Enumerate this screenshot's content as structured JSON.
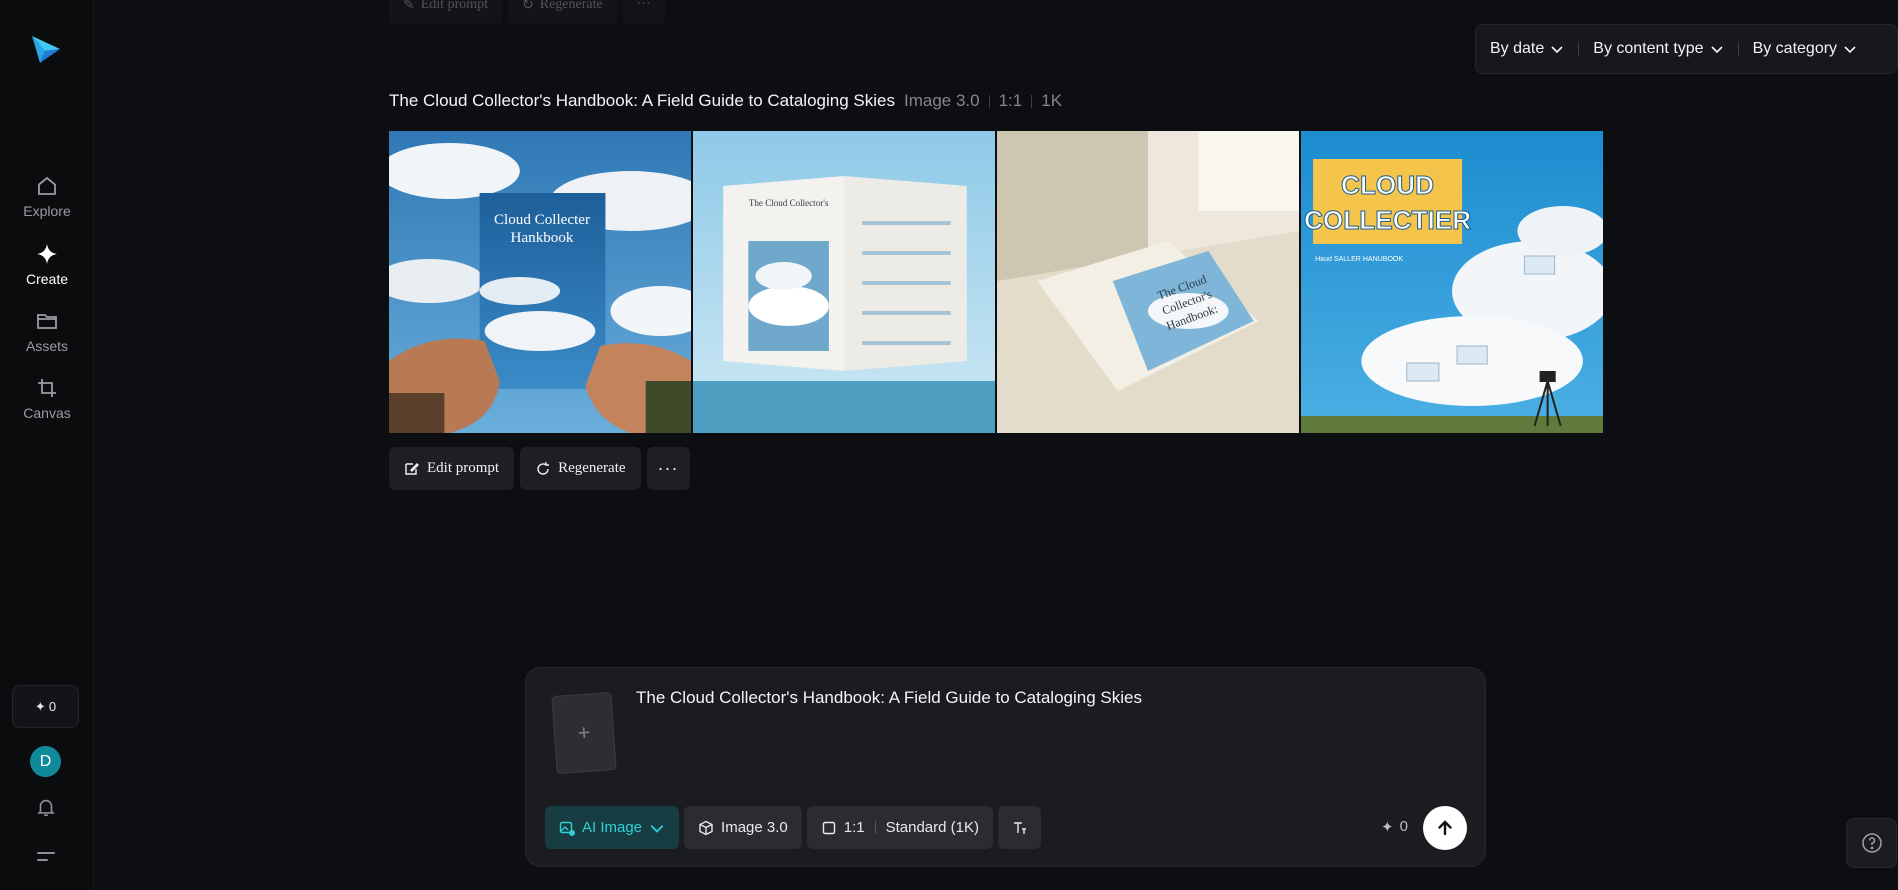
{
  "sidebar": {
    "nav": [
      {
        "label": "Explore",
        "icon": "home-icon"
      },
      {
        "label": "Create",
        "icon": "sparkle-icon",
        "active": true
      },
      {
        "label": "Assets",
        "icon": "folder-icon"
      },
      {
        "label": "Canvas",
        "icon": "crop-icon"
      }
    ],
    "credits": "0",
    "avatar_initial": "D"
  },
  "filters": {
    "by_date": "By date",
    "by_content_type": "By content type",
    "by_category": "By category"
  },
  "ghost_actions": {
    "edit": "Edit prompt",
    "regenerate": "Regenerate"
  },
  "result": {
    "title": "The Cloud Collector's Handbook: A Field Guide to Cataloging Skies",
    "model": "Image 3.0",
    "ratio": "1:1",
    "resolution": "1K",
    "images": [
      {
        "cover_line1": "Cloud Collecter",
        "cover_line2": "Hankbook"
      },
      {
        "page_title": "The Cloud Collector's"
      },
      {
        "cover_line1": "The Cloud",
        "cover_line2": "Collector's",
        "cover_line3": "Handbook:"
      },
      {
        "cover_line1": "CLOUD",
        "cover_line2": "COLLECTIER",
        "subtitle": "Haud SALLER HANUBOOK"
      }
    ],
    "actions": {
      "edit": "Edit prompt",
      "regenerate": "Regenerate",
      "more": "···"
    }
  },
  "composer": {
    "prompt": "The Cloud Collector's Handbook: A Field Guide to Cataloging Skies",
    "mode": "AI Image",
    "model": "Image 3.0",
    "ratio": "1:1",
    "quality": "Standard (1K)",
    "cost": "0",
    "accent_color": "#2fd0d8"
  }
}
